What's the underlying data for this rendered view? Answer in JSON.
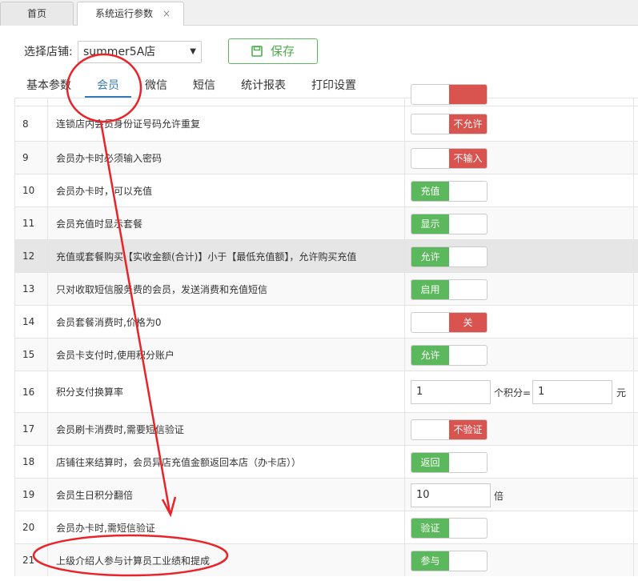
{
  "tabs": {
    "home": "首页",
    "active": "系统运行参数",
    "close": "×"
  },
  "header": {
    "store_label": "选择店铺:",
    "store_value": "summer5A店",
    "save_label": "保存"
  },
  "subtabs": [
    "基本参数",
    "会员",
    "微信",
    "短信",
    "统计报表",
    "打印设置"
  ],
  "active_subtab": "会员",
  "rows": [
    {
      "no": "8",
      "label": "连锁店内会员身份证号码允许重复",
      "state": "off",
      "text": "不允许"
    },
    {
      "no": "9",
      "label": "会员办卡时必须输入密码",
      "state": "off",
      "text": "不输入"
    },
    {
      "no": "10",
      "label": "会员办卡时，可以充值",
      "state": "on",
      "text": "充值"
    },
    {
      "no": "11",
      "label": "会员充值时显示套餐",
      "state": "on",
      "text": "显示"
    },
    {
      "no": "12",
      "label": "充值或套餐购买【实收金额(合计)】小于【最低充值额】，允许购买充值",
      "state": "on",
      "text": "允许"
    },
    {
      "no": "13",
      "label": "只对收取短信服务费的会员，发送消费和充值短信",
      "state": "on",
      "text": "启用"
    },
    {
      "no": "14",
      "label": "会员套餐消费时,价格为0",
      "state": "off",
      "text": "关"
    },
    {
      "no": "15",
      "label": "会员卡支付时,使用积分账户",
      "state": "on",
      "text": "允许"
    },
    {
      "no": "16",
      "label": "积分支付换算率",
      "input1": "1",
      "mid": "个积分=",
      "input2": "1",
      "unit": "元"
    },
    {
      "no": "17",
      "label": "会员刷卡消费时,需要短信验证",
      "state": "off",
      "text": "不验证"
    },
    {
      "no": "18",
      "label": "店铺往来结算时，会员异店充值金额返回本店（办卡店））",
      "state": "on",
      "text": "返回"
    },
    {
      "no": "19",
      "label": "会员生日积分翻倍",
      "input1": "10",
      "unit": "倍"
    },
    {
      "no": "20",
      "label": "会员办卡时,需短信验证",
      "state": "on",
      "text": "验证"
    },
    {
      "no": "21",
      "label": "上级介绍人参与计算员工业绩和提成",
      "state": "on",
      "text": "参与"
    }
  ],
  "colors": {
    "green": "#5cb85c",
    "red": "#d9534f",
    "annotation": "#e8242a",
    "accent": "#337ab7"
  }
}
